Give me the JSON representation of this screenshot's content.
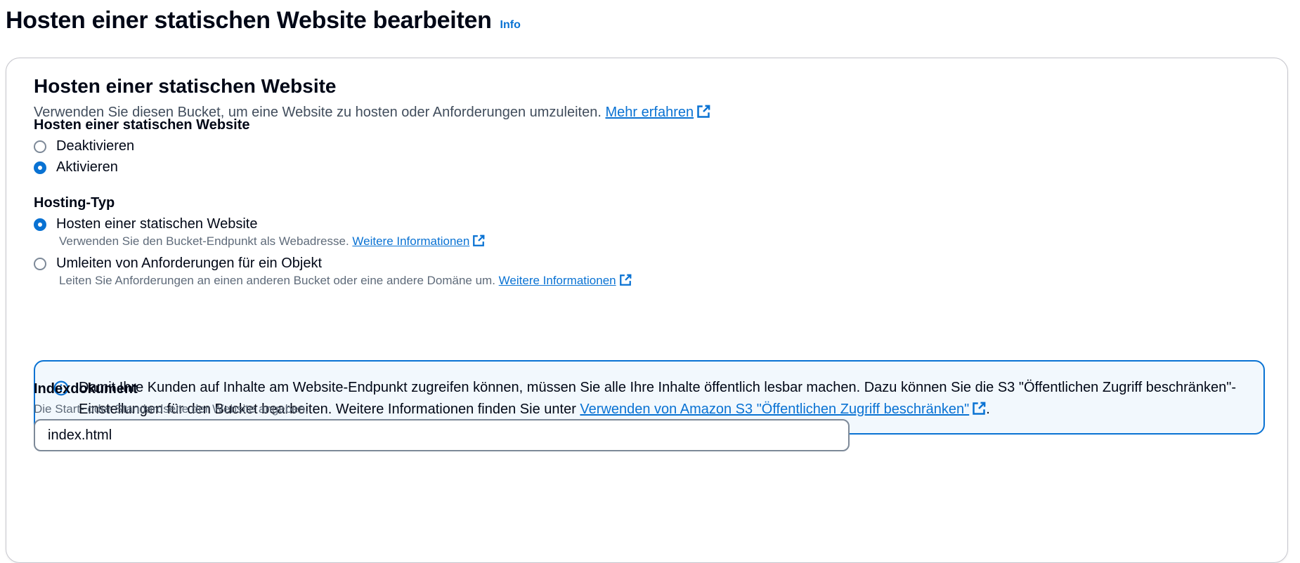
{
  "header": {
    "title": "Hosten einer statischen Website bearbeiten",
    "info_label": "Info"
  },
  "section": {
    "title": "Hosten einer statischen Website",
    "description": "Verwenden Sie diesen Bucket, um eine Website zu hosten oder Anforderungen umzuleiten. ",
    "learn_more_link": "Mehr erfahren"
  },
  "static_hosting": {
    "label": "Hosten einer statischen Website",
    "options": [
      {
        "label": "Deaktivieren",
        "selected": false
      },
      {
        "label": "Aktivieren",
        "selected": true
      }
    ]
  },
  "hosting_type": {
    "label": "Hosting-Typ",
    "options": [
      {
        "label": "Hosten einer statischen Website",
        "description": "Verwenden Sie den Bucket-Endpunkt als Webadresse. ",
        "link": "Weitere Informationen",
        "selected": true
      },
      {
        "label": "Umleiten von Anforderungen für ein Objekt",
        "description": "Leiten Sie Anforderungen an einen anderen Bucket oder eine andere Domäne um. ",
        "link": "Weitere Informationen",
        "selected": false
      }
    ]
  },
  "alert": {
    "icon": "info-circle-icon",
    "text": "Damit Ihre Kunden auf Inhalte am Website-Endpunkt zugreifen können, müssen Sie alle Ihre Inhalte öffentlich lesbar machen. Dazu können Sie die S3 \"Öffentlichen Zugriff beschränken\"-Einstellungen für den Bucket bearbeiten. Weitere Informationen finden Sie unter ",
    "link": "Verwenden von Amazon S3 \"Öffentlichen Zugriff beschränken\"",
    "suffix": "."
  },
  "index_document": {
    "label": "Indexdokument",
    "description": "Die Start- oder Standardseite der Website angeben.",
    "value": "index.html"
  },
  "colors": {
    "accent": "#0972d3",
    "alert_background": "#f2f8fd",
    "text": "#000716",
    "secondary_text": "#5f6b7a"
  }
}
